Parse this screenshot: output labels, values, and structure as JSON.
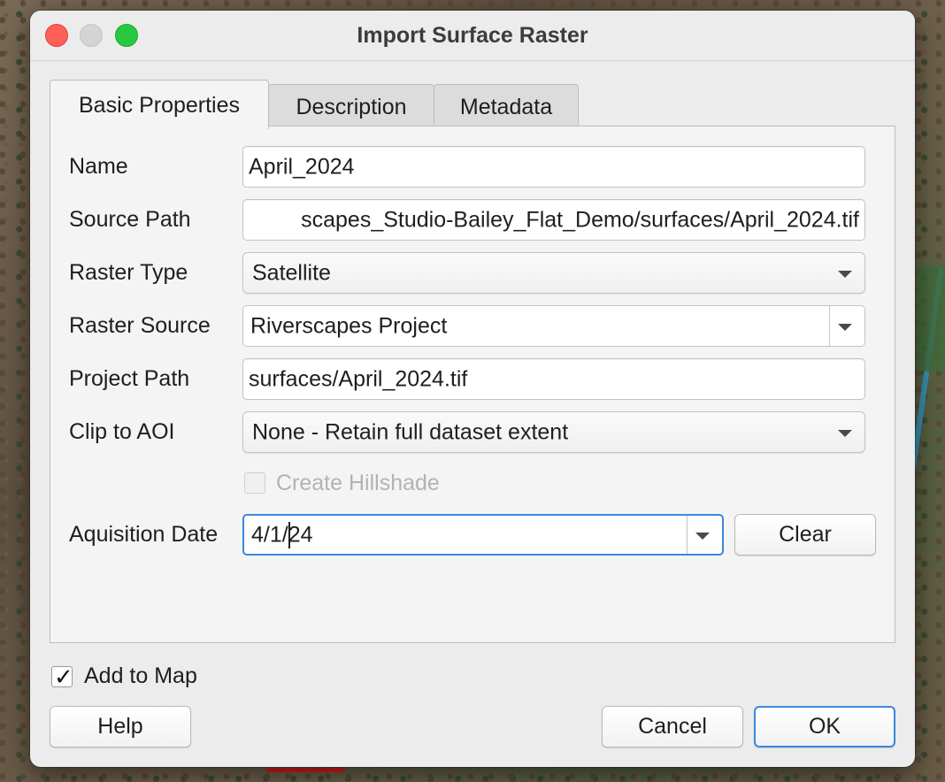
{
  "window": {
    "title": "Import Surface Raster"
  },
  "tabs": [
    {
      "label": "Basic Properties",
      "active": true
    },
    {
      "label": "Description",
      "active": false
    },
    {
      "label": "Metadata",
      "active": false
    }
  ],
  "form": {
    "name": {
      "label": "Name",
      "value": "April_2024"
    },
    "source_path": {
      "label": "Source Path",
      "value": "scapes_Studio-Bailey_Flat_Demo/surfaces/April_2024.tif"
    },
    "raster_type": {
      "label": "Raster Type",
      "value": "Satellite"
    },
    "raster_source": {
      "label": "Raster Source",
      "value": "Riverscapes Project"
    },
    "project_path": {
      "label": "Project Path",
      "value": "surfaces/April_2024.tif"
    },
    "clip_to_aoi": {
      "label": "Clip to AOI",
      "value": "None - Retain full dataset extent"
    },
    "create_hillshade": {
      "label": "Create Hillshade",
      "checked": false,
      "enabled": false
    },
    "acquisition_date": {
      "label": "Aquisition Date",
      "value": "4/1/24",
      "clear_label": "Clear"
    }
  },
  "add_to_map": {
    "label": "Add to Map",
    "checked": true
  },
  "buttons": {
    "help": "Help",
    "cancel": "Cancel",
    "ok": "OK"
  },
  "colors": {
    "accent": "#3b87e0",
    "close": "#fe5f57",
    "maximize": "#28c840"
  },
  "icons": {
    "dropdown": "chevron-down-icon",
    "check": "checkmark-icon"
  }
}
